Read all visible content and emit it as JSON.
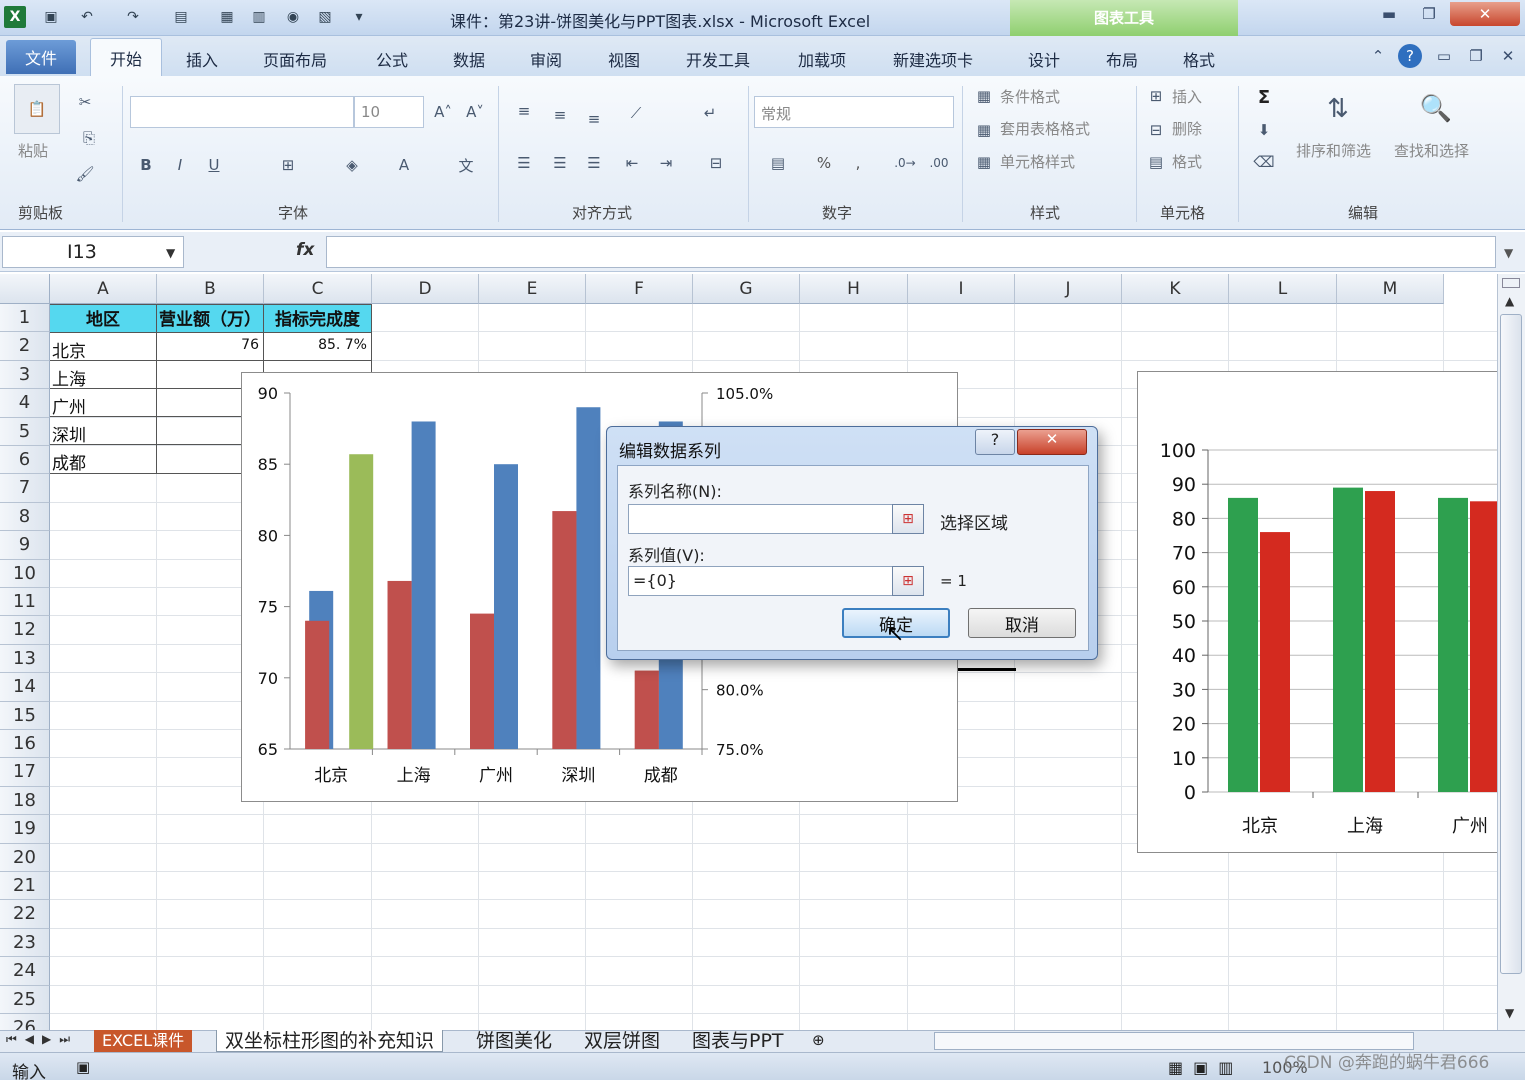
{
  "window": {
    "title": "课件：第23讲-饼图美化与PPT图表.xlsx - Microsoft Excel",
    "context_tools": "图表工具"
  },
  "tabs": [
    "文件",
    "开始",
    "插入",
    "页面布局",
    "公式",
    "数据",
    "审阅",
    "视图",
    "开发工具",
    "加载项",
    "新建选项卡",
    "设计",
    "布局",
    "格式"
  ],
  "ribbon": {
    "clipboard": {
      "paste": "粘贴",
      "group": "剪贴板"
    },
    "font": {
      "size": "10",
      "group": "字体"
    },
    "alignment": {
      "group": "对齐方式"
    },
    "number": {
      "format": "常规",
      "percent": "%",
      "comma": ",",
      "group": "数字"
    },
    "styles": {
      "conditional": "条件格式",
      "table": "套用表格格式",
      "cell": "单元格样式",
      "group": "样式"
    },
    "cells": {
      "insert": "插入",
      "delete": "删除",
      "format": "格式",
      "group": "单元格"
    },
    "editing": {
      "sum": "Σ",
      "sort": "排序和筛选",
      "find": "查找和选择",
      "group": "编辑"
    }
  },
  "formula_bar": {
    "name_box": "I13",
    "fx": "fx",
    "value": ""
  },
  "columns": [
    "A",
    "B",
    "C",
    "D",
    "E",
    "F",
    "G",
    "H",
    "I",
    "J",
    "K",
    "L",
    "M"
  ],
  "rows": [
    "1",
    "2",
    "3",
    "4",
    "5",
    "6",
    "7",
    "8",
    "9",
    "10",
    "11",
    "12",
    "13",
    "14",
    "15",
    "16",
    "17",
    "18",
    "19",
    "20",
    "21",
    "22",
    "23",
    "24",
    "25",
    "26"
  ],
  "table": {
    "headers": [
      "地区",
      "营业额（万）",
      "指标完成度"
    ],
    "regions": [
      "北京",
      "上海",
      "广州",
      "深圳",
      "成都"
    ],
    "b2": "76",
    "c2": "85. 7%"
  },
  "chart_data": [
    {
      "type": "bar",
      "categories": [
        "北京",
        "上海",
        "广州",
        "深圳",
        "成都"
      ],
      "y_ticks": [
        "90",
        "85",
        "80",
        "75",
        "70",
        "65"
      ],
      "y2_ticks": [
        "105.0%",
        "80.0%",
        "75.0%"
      ],
      "ylim": [
        65,
        90
      ],
      "y2lim": [
        75,
        105
      ],
      "series": [
        {
          "color": "#c0504d",
          "values": [
            74,
            76.8,
            74.5,
            81.7,
            70.5
          ],
          "axis": "primary"
        },
        {
          "color": "#4f81bd",
          "values": [
            76.1,
            88,
            85,
            89,
            88
          ],
          "axis": "primary"
        },
        {
          "color": "#9bbb59",
          "values": [
            85.7,
            null,
            null,
            null,
            null
          ],
          "axis": "primary"
        }
      ]
    },
    {
      "type": "bar",
      "categories": [
        "北京",
        "上海",
        "广州"
      ],
      "y_ticks": [
        "100",
        "90",
        "80",
        "70",
        "60",
        "50",
        "40",
        "30",
        "20",
        "10",
        "0"
      ],
      "ylim": [
        0,
        100
      ],
      "series": [
        {
          "color": "#2ea04f",
          "values": [
            86,
            89,
            86
          ]
        },
        {
          "color": "#d42a1f",
          "values": [
            76,
            88,
            85
          ]
        }
      ]
    }
  ],
  "dialog": {
    "title": "编辑数据系列",
    "help": "?",
    "close": "✕",
    "name_label": "系列名称(N):",
    "name_value": "",
    "name_hint": "选择区域",
    "values_label": "系列值(V):",
    "values_value": "={0}",
    "values_result": "= 1",
    "ok": "确定",
    "cancel": "取消"
  },
  "sheets": [
    "EXCEL课件",
    "双坐标柱形图的补充知识",
    "饼图美化",
    "双层饼图",
    "图表与PPT"
  ],
  "status": {
    "mode": "输入",
    "zoom": "100%",
    "watermark": "CSDN @奔跑的蜗牛君666"
  }
}
